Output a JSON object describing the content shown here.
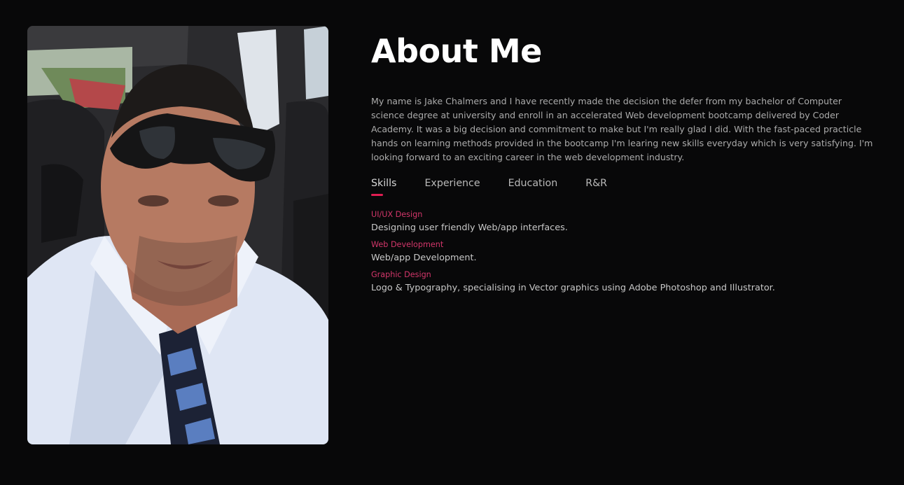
{
  "about": {
    "title": "About Me",
    "photo_alt": "profile-photo",
    "bio": "My name is Jake Chalmers and I have recently made the decision the defer from my bachelor of Computer science degree at university and enroll in an accelerated Web development bootcamp delivered by Coder Academy. It was a big decision and commitment to make but I'm really glad I did. With the fast-paced practicle hands on learning methods provided in the bootcamp I'm learing new skills everyday which is very satisfying. I'm looking forward to an exciting career in the web development industry."
  },
  "tabs": [
    {
      "label": "Skills",
      "active": true
    },
    {
      "label": "Experience",
      "active": false
    },
    {
      "label": "Education",
      "active": false
    },
    {
      "label": "R&R",
      "active": false
    }
  ],
  "skills": [
    {
      "name": "UI/UX Design",
      "description": "Designing user friendly Web/app interfaces."
    },
    {
      "name": "Web Development",
      "description": "Web/app Development."
    },
    {
      "name": "Graphic Design",
      "description": "Logo & Typography, specialising in Vector graphics using Adobe Photoshop and Illustrator."
    }
  ],
  "colors": {
    "background": "#080809",
    "accent": "#e01d52",
    "skill_name": "#d2366a",
    "text": "#ababab"
  }
}
